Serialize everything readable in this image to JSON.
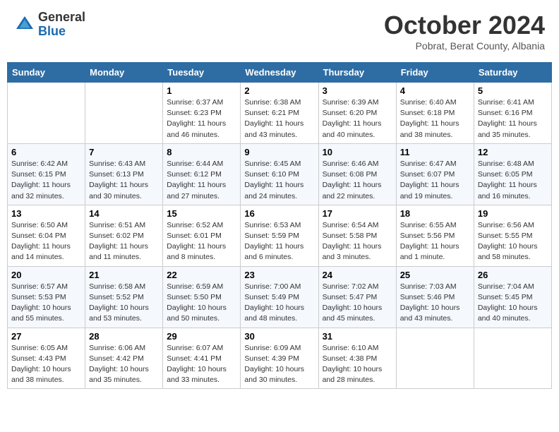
{
  "header": {
    "logo_general": "General",
    "logo_blue": "Blue",
    "month": "October 2024",
    "location": "Pobrat, Berat County, Albania"
  },
  "weekdays": [
    "Sunday",
    "Monday",
    "Tuesday",
    "Wednesday",
    "Thursday",
    "Friday",
    "Saturday"
  ],
  "weeks": [
    [
      {
        "day": "",
        "sunrise": "",
        "sunset": "",
        "daylight": ""
      },
      {
        "day": "",
        "sunrise": "",
        "sunset": "",
        "daylight": ""
      },
      {
        "day": "1",
        "sunrise": "Sunrise: 6:37 AM",
        "sunset": "Sunset: 6:23 PM",
        "daylight": "Daylight: 11 hours and 46 minutes."
      },
      {
        "day": "2",
        "sunrise": "Sunrise: 6:38 AM",
        "sunset": "Sunset: 6:21 PM",
        "daylight": "Daylight: 11 hours and 43 minutes."
      },
      {
        "day": "3",
        "sunrise": "Sunrise: 6:39 AM",
        "sunset": "Sunset: 6:20 PM",
        "daylight": "Daylight: 11 hours and 40 minutes."
      },
      {
        "day": "4",
        "sunrise": "Sunrise: 6:40 AM",
        "sunset": "Sunset: 6:18 PM",
        "daylight": "Daylight: 11 hours and 38 minutes."
      },
      {
        "day": "5",
        "sunrise": "Sunrise: 6:41 AM",
        "sunset": "Sunset: 6:16 PM",
        "daylight": "Daylight: 11 hours and 35 minutes."
      }
    ],
    [
      {
        "day": "6",
        "sunrise": "Sunrise: 6:42 AM",
        "sunset": "Sunset: 6:15 PM",
        "daylight": "Daylight: 11 hours and 32 minutes."
      },
      {
        "day": "7",
        "sunrise": "Sunrise: 6:43 AM",
        "sunset": "Sunset: 6:13 PM",
        "daylight": "Daylight: 11 hours and 30 minutes."
      },
      {
        "day": "8",
        "sunrise": "Sunrise: 6:44 AM",
        "sunset": "Sunset: 6:12 PM",
        "daylight": "Daylight: 11 hours and 27 minutes."
      },
      {
        "day": "9",
        "sunrise": "Sunrise: 6:45 AM",
        "sunset": "Sunset: 6:10 PM",
        "daylight": "Daylight: 11 hours and 24 minutes."
      },
      {
        "day": "10",
        "sunrise": "Sunrise: 6:46 AM",
        "sunset": "Sunset: 6:08 PM",
        "daylight": "Daylight: 11 hours and 22 minutes."
      },
      {
        "day": "11",
        "sunrise": "Sunrise: 6:47 AM",
        "sunset": "Sunset: 6:07 PM",
        "daylight": "Daylight: 11 hours and 19 minutes."
      },
      {
        "day": "12",
        "sunrise": "Sunrise: 6:48 AM",
        "sunset": "Sunset: 6:05 PM",
        "daylight": "Daylight: 11 hours and 16 minutes."
      }
    ],
    [
      {
        "day": "13",
        "sunrise": "Sunrise: 6:50 AM",
        "sunset": "Sunset: 6:04 PM",
        "daylight": "Daylight: 11 hours and 14 minutes."
      },
      {
        "day": "14",
        "sunrise": "Sunrise: 6:51 AM",
        "sunset": "Sunset: 6:02 PM",
        "daylight": "Daylight: 11 hours and 11 minutes."
      },
      {
        "day": "15",
        "sunrise": "Sunrise: 6:52 AM",
        "sunset": "Sunset: 6:01 PM",
        "daylight": "Daylight: 11 hours and 8 minutes."
      },
      {
        "day": "16",
        "sunrise": "Sunrise: 6:53 AM",
        "sunset": "Sunset: 5:59 PM",
        "daylight": "Daylight: 11 hours and 6 minutes."
      },
      {
        "day": "17",
        "sunrise": "Sunrise: 6:54 AM",
        "sunset": "Sunset: 5:58 PM",
        "daylight": "Daylight: 11 hours and 3 minutes."
      },
      {
        "day": "18",
        "sunrise": "Sunrise: 6:55 AM",
        "sunset": "Sunset: 5:56 PM",
        "daylight": "Daylight: 11 hours and 1 minute."
      },
      {
        "day": "19",
        "sunrise": "Sunrise: 6:56 AM",
        "sunset": "Sunset: 5:55 PM",
        "daylight": "Daylight: 10 hours and 58 minutes."
      }
    ],
    [
      {
        "day": "20",
        "sunrise": "Sunrise: 6:57 AM",
        "sunset": "Sunset: 5:53 PM",
        "daylight": "Daylight: 10 hours and 55 minutes."
      },
      {
        "day": "21",
        "sunrise": "Sunrise: 6:58 AM",
        "sunset": "Sunset: 5:52 PM",
        "daylight": "Daylight: 10 hours and 53 minutes."
      },
      {
        "day": "22",
        "sunrise": "Sunrise: 6:59 AM",
        "sunset": "Sunset: 5:50 PM",
        "daylight": "Daylight: 10 hours and 50 minutes."
      },
      {
        "day": "23",
        "sunrise": "Sunrise: 7:00 AM",
        "sunset": "Sunset: 5:49 PM",
        "daylight": "Daylight: 10 hours and 48 minutes."
      },
      {
        "day": "24",
        "sunrise": "Sunrise: 7:02 AM",
        "sunset": "Sunset: 5:47 PM",
        "daylight": "Daylight: 10 hours and 45 minutes."
      },
      {
        "day": "25",
        "sunrise": "Sunrise: 7:03 AM",
        "sunset": "Sunset: 5:46 PM",
        "daylight": "Daylight: 10 hours and 43 minutes."
      },
      {
        "day": "26",
        "sunrise": "Sunrise: 7:04 AM",
        "sunset": "Sunset: 5:45 PM",
        "daylight": "Daylight: 10 hours and 40 minutes."
      }
    ],
    [
      {
        "day": "27",
        "sunrise": "Sunrise: 6:05 AM",
        "sunset": "Sunset: 4:43 PM",
        "daylight": "Daylight: 10 hours and 38 minutes."
      },
      {
        "day": "28",
        "sunrise": "Sunrise: 6:06 AM",
        "sunset": "Sunset: 4:42 PM",
        "daylight": "Daylight: 10 hours and 35 minutes."
      },
      {
        "day": "29",
        "sunrise": "Sunrise: 6:07 AM",
        "sunset": "Sunset: 4:41 PM",
        "daylight": "Daylight: 10 hours and 33 minutes."
      },
      {
        "day": "30",
        "sunrise": "Sunrise: 6:09 AM",
        "sunset": "Sunset: 4:39 PM",
        "daylight": "Daylight: 10 hours and 30 minutes."
      },
      {
        "day": "31",
        "sunrise": "Sunrise: 6:10 AM",
        "sunset": "Sunset: 4:38 PM",
        "daylight": "Daylight: 10 hours and 28 minutes."
      },
      {
        "day": "",
        "sunrise": "",
        "sunset": "",
        "daylight": ""
      },
      {
        "day": "",
        "sunrise": "",
        "sunset": "",
        "daylight": ""
      }
    ]
  ]
}
